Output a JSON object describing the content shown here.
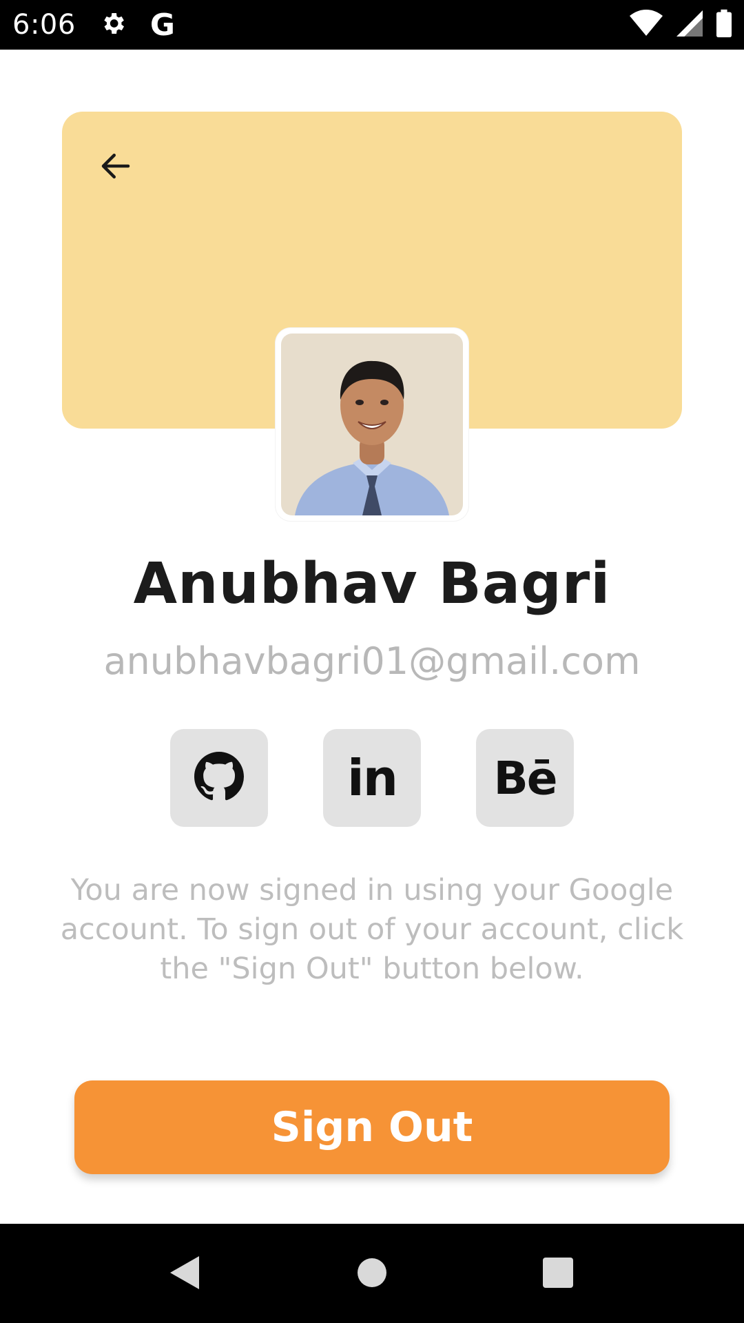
{
  "status_bar": {
    "time": "6:06",
    "icons": [
      "settings-icon",
      "google-g-icon",
      "wifi-icon",
      "signal-icon",
      "battery-icon"
    ],
    "google_letter": "G"
  },
  "header": {
    "background_color": "#f9dc97",
    "back_icon": "arrow-left-icon"
  },
  "profile": {
    "name": "Anubhav Bagri",
    "email": "anubhavbagri01@gmail.com",
    "avatar": "profile-photo"
  },
  "social": {
    "items": [
      {
        "id": "github",
        "icon": "github-icon",
        "label": ""
      },
      {
        "id": "linkedin",
        "icon": "linkedin-icon",
        "label": "in"
      },
      {
        "id": "behance",
        "icon": "behance-icon",
        "label": "Bē"
      }
    ],
    "button_color": "#e2e2e2"
  },
  "info": {
    "text": "You are now signed in using your Google account. To sign out of your account, click the \"Sign Out\" button below."
  },
  "actions": {
    "sign_out_label": "Sign Out",
    "sign_out_color": "#f69336"
  },
  "nav_bar": {
    "items": [
      "back-triangle-icon",
      "home-circle-icon",
      "recents-square-icon"
    ]
  }
}
